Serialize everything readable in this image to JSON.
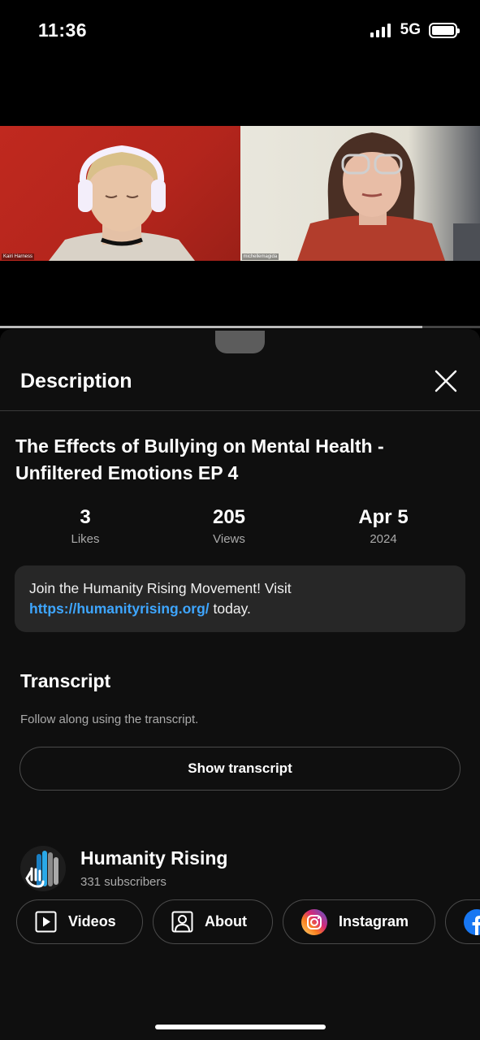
{
  "status_bar": {
    "time": "11:36",
    "network": "5G"
  },
  "video": {
    "participants": [
      "Kairi Harness",
      "michellemagida"
    ],
    "progress_fraction": 0.88
  },
  "sheet": {
    "title": "Description",
    "video_title": "The Effects of Bullying on Mental Health - Unfiltered Emotions EP 4",
    "stats": [
      {
        "value": "3",
        "label": "Likes"
      },
      {
        "value": "205",
        "label": "Views"
      },
      {
        "value": "Apr 5",
        "label": "2024"
      }
    ],
    "description": {
      "text_before": "Join the Humanity Rising Movement! Visit ",
      "link": "https://humanityrising.org/",
      "text_after": " today."
    },
    "transcript": {
      "title": "Transcript",
      "subtitle": "Follow along using the transcript.",
      "button": "Show transcript"
    },
    "channel": {
      "name": "Humanity Rising",
      "subscribers": "331 subscribers"
    },
    "chips": [
      {
        "label": "Videos",
        "icon": "play-box-icon"
      },
      {
        "label": "About",
        "icon": "person-box-icon"
      },
      {
        "label": "Instagram",
        "icon": "instagram-icon"
      },
      {
        "label": "",
        "icon": "facebook-icon"
      }
    ]
  },
  "colors": {
    "link": "#3ea6ff",
    "sheet_bg": "#0f0f0f",
    "box_bg": "#272727"
  }
}
